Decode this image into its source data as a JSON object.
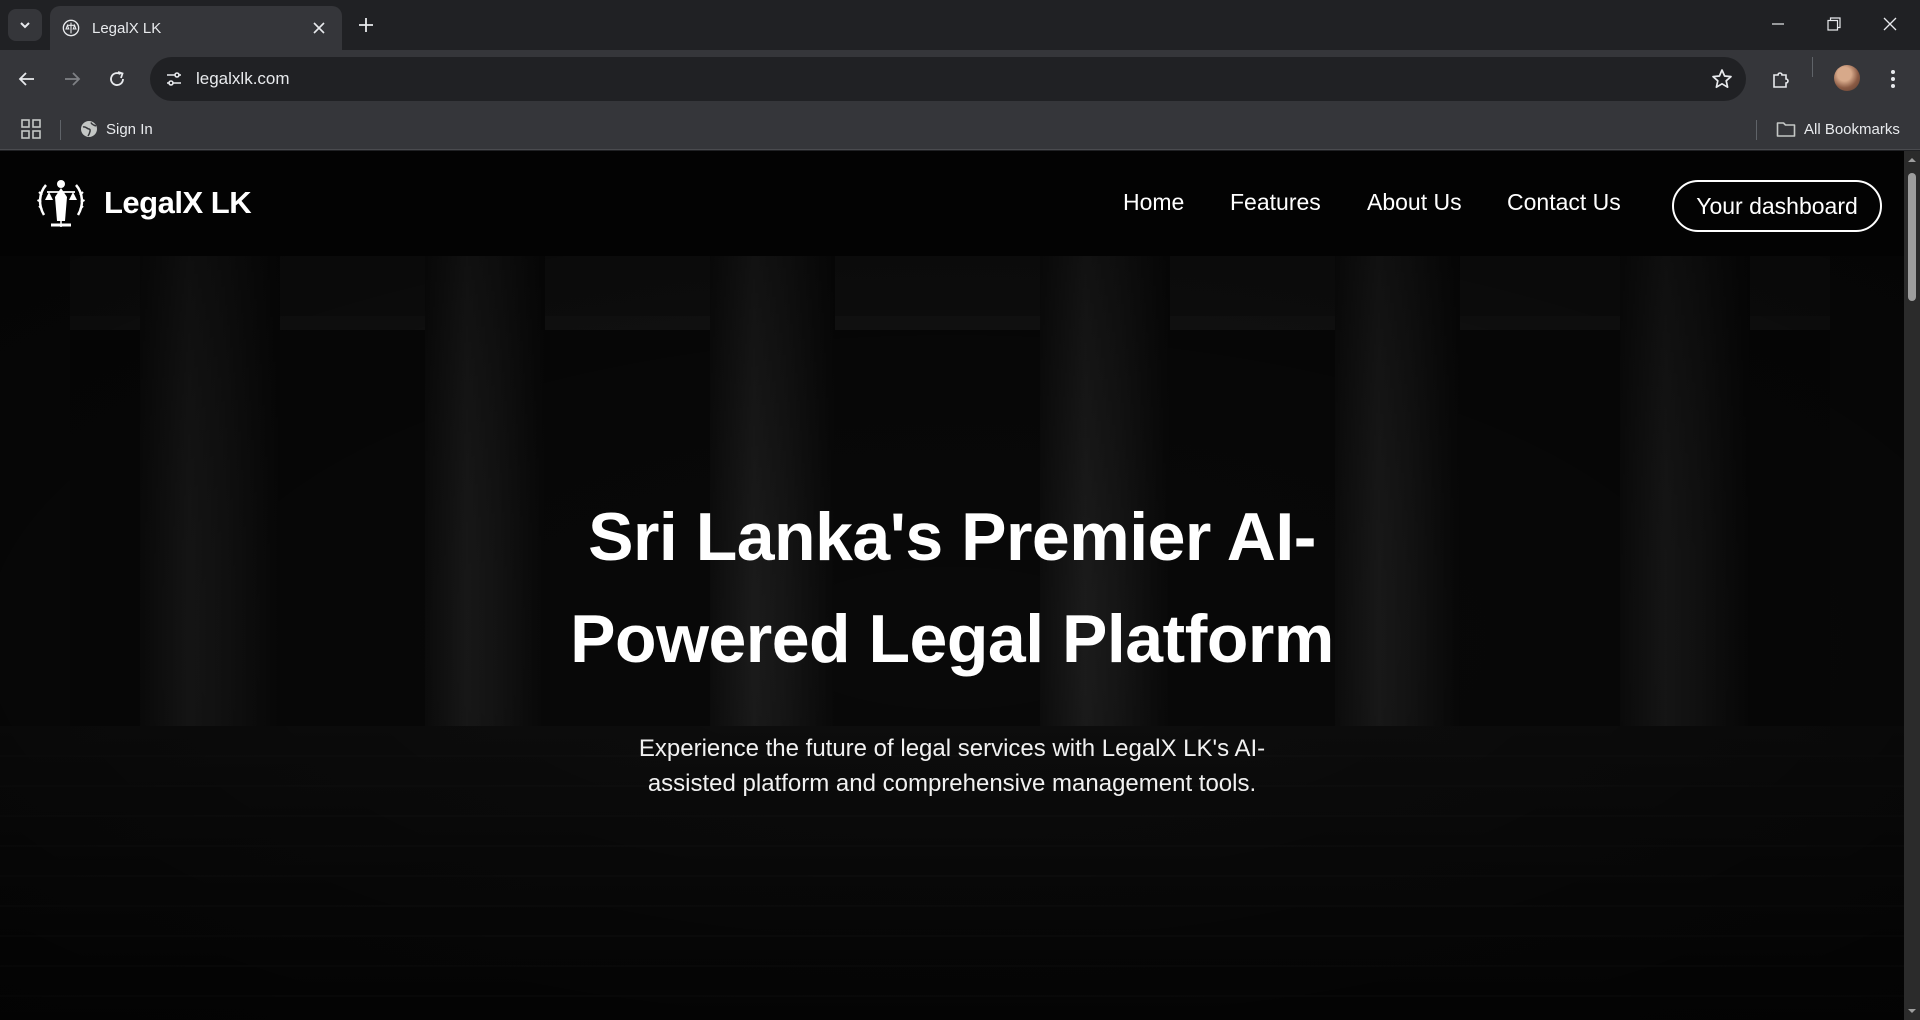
{
  "browser": {
    "tab_title": "LegalX LK",
    "url": "legalxlk.com",
    "bookmarks": {
      "sign_in": "Sign In",
      "all_bookmarks": "All Bookmarks"
    }
  },
  "site": {
    "brand": "LegalX LK",
    "nav": {
      "home": "Home",
      "features": "Features",
      "about": "About Us",
      "contact": "Contact Us",
      "dashboard": "Your dashboard"
    },
    "hero": {
      "title_line1": "Sri Lanka's Premier AI-",
      "title_line2": "Powered Legal Platform",
      "subtitle_line1": "Experience the future of legal services with LegalX LK's AI-",
      "subtitle_line2": "assisted platform and comprehensive management tools."
    }
  },
  "colors": {
    "chrome_dark": "#202124",
    "chrome_toolbar": "#35363a",
    "page_bg": "#050505",
    "text_primary": "#ffffff"
  },
  "icons": {
    "tab_search": "chevron-down-icon",
    "favicon": "lady-justice-icon",
    "back": "arrow-left-icon",
    "forward": "arrow-right-icon",
    "reload": "reload-icon",
    "site_info": "tune-icon",
    "bookmark_star": "star-icon",
    "extensions": "puzzle-icon",
    "menu": "kebab-icon"
  }
}
